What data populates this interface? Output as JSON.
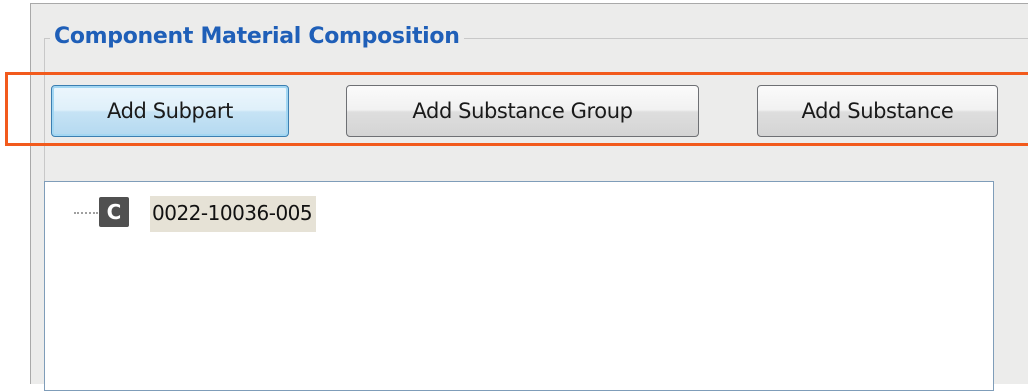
{
  "groupbox": {
    "title": "Component Material Composition"
  },
  "buttons": {
    "add_subpart": "Add Subpart",
    "add_substance_group": "Add Substance Group",
    "add_substance": "Add Substance"
  },
  "tree": {
    "root_node": {
      "icon_letter": "C",
      "icon": "component-icon",
      "label": "0022-10036-005"
    }
  },
  "colors": {
    "title_text": "#1f5fb8",
    "highlight_outline": "#f25a1c",
    "panel_background": "#ececeb",
    "node_icon_background": "#505050",
    "selected_node_background": "#e6e2d6"
  }
}
